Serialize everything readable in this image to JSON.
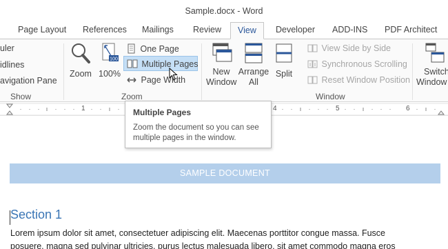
{
  "window": {
    "title": "Sample.docx - Word"
  },
  "tabs": [
    {
      "label": "Page Layout"
    },
    {
      "label": "References"
    },
    {
      "label": "Mailings"
    },
    {
      "label": "Review"
    },
    {
      "label": "View"
    },
    {
      "label": "Developer"
    },
    {
      "label": "ADD-INS"
    },
    {
      "label": "PDF Architect"
    }
  ],
  "ribbon": {
    "show": {
      "label": "Show",
      "items": [
        "uler",
        "idlines",
        "avigation Pane"
      ]
    },
    "zoom": {
      "label": "Zoom",
      "zoom_button": "Zoom",
      "hundred_button": "100%",
      "hundred_badge": "100",
      "one_page": "One Page",
      "multiple_pages": "Multiple Pages",
      "page_width": "Page Width"
    },
    "window": {
      "label": "Window",
      "new_window": [
        "New",
        "Window"
      ],
      "arrange_all": [
        "Arrange",
        "All"
      ],
      "split": "Split",
      "view_side_by_side": "View Side by Side",
      "synchronous_scrolling": "Synchronous Scrolling",
      "reset_window_position": "Reset Window Position",
      "switch_windows": [
        "Switch",
        "Window"
      ]
    }
  },
  "ruler": {
    "numbers": [
      "1",
      "4",
      "5",
      "6"
    ]
  },
  "tooltip": {
    "title": "Multiple Pages",
    "body": "Zoom the document so you can see multiple pages in the window."
  },
  "document": {
    "banner": "SAMPLE DOCUMENT",
    "heading": "Section 1",
    "line1": "Lorem ipsum dolor sit amet, consectetuer adipiscing elit. Maecenas porttitor congue massa. Fusce",
    "line2": "posuere, magna sed pulvinar ultricies, purus lectus malesuada libero, sit amet commodo magna eros"
  },
  "colors": {
    "accent": "#2b579a",
    "banner": "#b4cfeb",
    "heading": "#3a75b5"
  }
}
